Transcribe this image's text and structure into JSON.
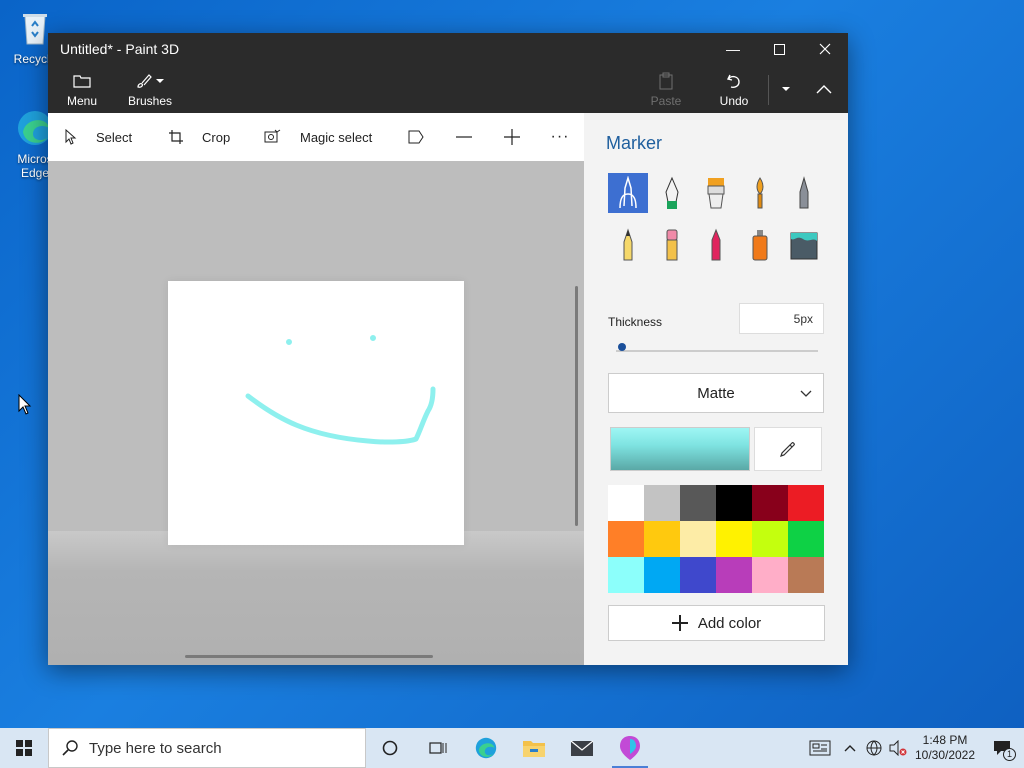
{
  "desktop": {
    "icons": [
      {
        "label": "Recycle"
      },
      {
        "label": "Micros Edge"
      }
    ]
  },
  "window": {
    "title": "Untitled* - Paint 3D"
  },
  "ribbon": {
    "menu_label": "Menu",
    "brushes_label": "Brushes",
    "paste_label": "Paste",
    "undo_label": "Undo"
  },
  "toolbar": {
    "select_label": "Select",
    "crop_label": "Crop",
    "magic_select_label": "Magic select"
  },
  "panel": {
    "title": "Marker",
    "brushes": [
      "marker",
      "calligraphy-pen",
      "oil-brush",
      "watercolor",
      "pixel-pen",
      "pencil",
      "eraser",
      "crayon",
      "spray-can",
      "fill"
    ],
    "thickness_label": "Thickness",
    "thickness_value": "5px",
    "thickness_fraction": 0.02,
    "finish_value": "Matte",
    "current_color": "#9ff6f4",
    "palette": [
      "#ffffff",
      "#c3c3c3",
      "#585858",
      "#000000",
      "#88001b",
      "#ec1c24",
      "#ff7f27",
      "#ffc90e",
      "#fdeca6",
      "#fff200",
      "#c4ff0e",
      "#0ed145",
      "#8cfffb",
      "#00a8f3",
      "#3f48cc",
      "#b83dba",
      "#ffaec8",
      "#b97a56"
    ],
    "add_color_label": "Add color"
  },
  "taskbar": {
    "search_placeholder": "Type here to search",
    "time": "1:48 PM",
    "date": "10/30/2022",
    "notification_count": "1"
  }
}
